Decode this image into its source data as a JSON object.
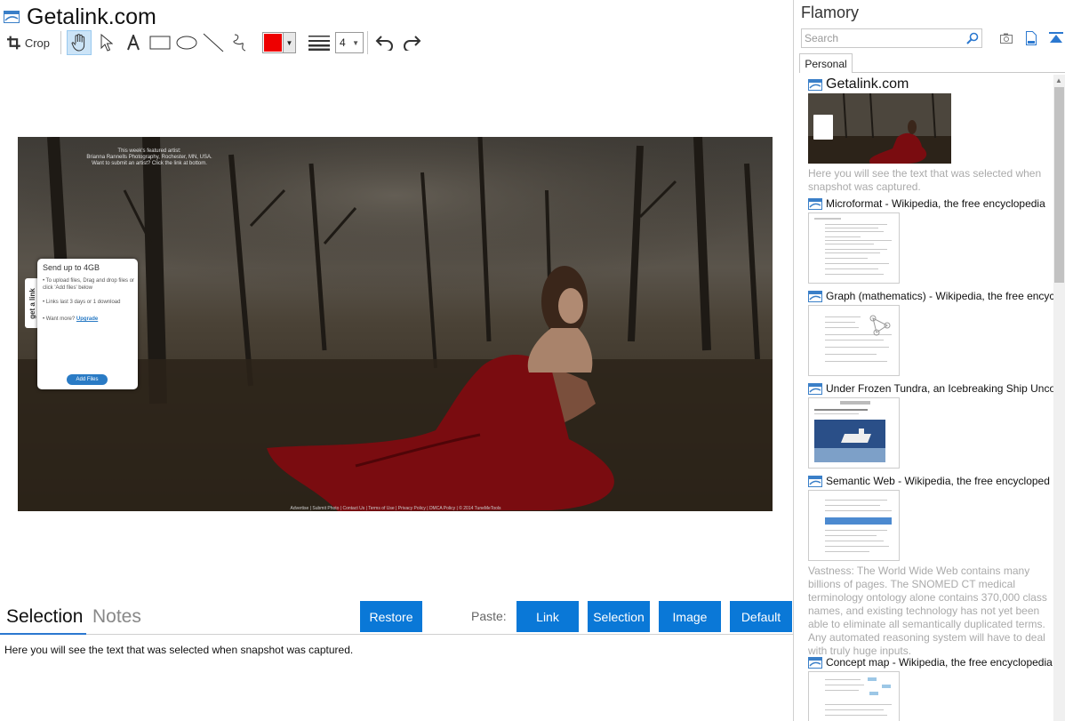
{
  "window": {
    "title": "Getalink.com"
  },
  "toolbar": {
    "crop_label": "Crop",
    "line_width": "4"
  },
  "colors": {
    "accent": "#0a78d7",
    "pen": "#ee0000",
    "link": "#2b78d0"
  },
  "preview": {
    "featured_text": [
      "This week's featured artist:",
      "Brianna Rannells Photography, Rochester, MN, USA.",
      "Want to submit an artist? Click the link at bottom."
    ],
    "widget": {
      "tab_label": "get a link",
      "title": "Send up to 4GB",
      "line1": "• To upload files, Drag and drop files or click 'Add files' below",
      "line2": "• Links last 3 days or 1 download",
      "line3": "• Want more?",
      "upgrade": "Upgrade",
      "add_files": "Add Files"
    },
    "footer_links": "Advertise | Submit Photo | Contact Us | Terms of Use | Privacy Policy | DMCA Policy | © 2014 TuneMeTools"
  },
  "bottom": {
    "tab_selection": "Selection",
    "tab_notes": "Notes",
    "restore": "Restore",
    "paste_label": "Paste:",
    "paste_link": "Link",
    "paste_selection": "Selection",
    "paste_image": "Image",
    "paste_default": "Default",
    "selection_text": "Here you will see the text that was selected when snapshot was captured."
  },
  "sidebar": {
    "title": "Flamory",
    "search_placeholder": "Search",
    "tab": "Personal",
    "items": [
      {
        "title": "Getalink.com",
        "desc": "Here you will see the text that was selected when snapshot was captured."
      },
      {
        "title": "Microformat - Wikipedia, the free encyclopedia"
      },
      {
        "title": "Graph (mathematics) - Wikipedia, the free encyc"
      },
      {
        "title": "Under Frozen Tundra, an Icebreaking Ship Unco"
      },
      {
        "title": "Semantic Web - Wikipedia, the free encycloped",
        "desc": "Vastness: The World Wide Web contains many billions of pages. The SNOMED CT medical terminology ontology alone contains 370,000 class names, and existing technology has not yet been able to eliminate all semantically duplicated terms. Any automated reasoning system will have to deal with truly huge inputs."
      },
      {
        "title": "Concept map - Wikipedia, the free encyclopedia"
      }
    ]
  }
}
